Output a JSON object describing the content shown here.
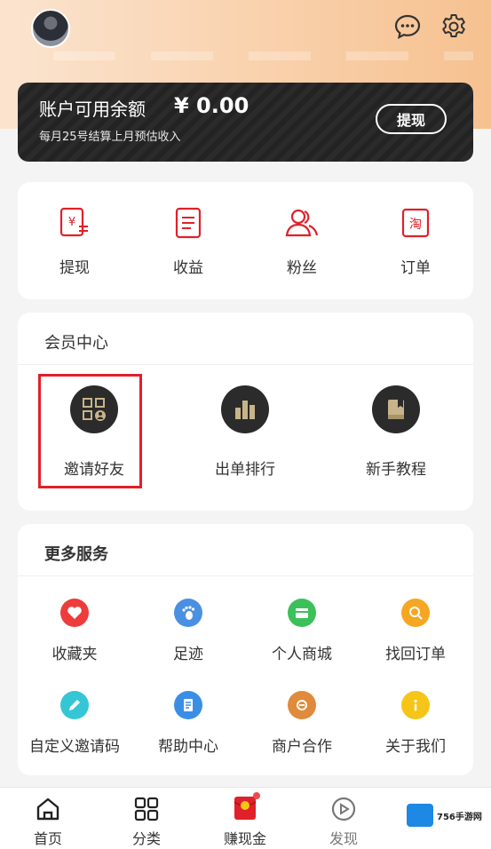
{
  "header": {
    "balance_title": "账户可用余额",
    "balance_amount": "¥ 0.00",
    "balance_subtitle": "每月25号结算上月预估收入",
    "withdraw_button": "提现"
  },
  "quick_actions": [
    {
      "label": "提现",
      "icon": "withdraw-icon"
    },
    {
      "label": "收益",
      "icon": "earnings-icon"
    },
    {
      "label": "粉丝",
      "icon": "fans-icon"
    },
    {
      "label": "订单",
      "icon": "taobao-order-icon"
    }
  ],
  "member_center": {
    "title": "会员中心",
    "items": [
      {
        "label": "邀请好友",
        "icon": "qr-invite-icon"
      },
      {
        "label": "出单排行",
        "icon": "ranking-icon"
      },
      {
        "label": "新手教程",
        "icon": "tutorial-book-icon"
      }
    ]
  },
  "more_services": {
    "title": "更多服务",
    "items": [
      {
        "label": "收藏夹",
        "icon": "heart-icon",
        "color": "#ee3b3b"
      },
      {
        "label": "足迹",
        "icon": "footprint-icon",
        "color": "#4a90e2"
      },
      {
        "label": "个人商城",
        "icon": "mall-icon",
        "color": "#3cc05a"
      },
      {
        "label": "找回订单",
        "icon": "search-order-icon",
        "color": "#f5a623"
      },
      {
        "label": "自定义邀请码",
        "icon": "edit-icon",
        "color": "#35c6d6"
      },
      {
        "label": "帮助中心",
        "icon": "help-icon",
        "color": "#3a8ee6"
      },
      {
        "label": "商户合作",
        "icon": "cooperation-icon",
        "color": "#e08a3c"
      },
      {
        "label": "关于我们",
        "icon": "info-icon",
        "color": "#f5c518"
      }
    ]
  },
  "tabbar": [
    {
      "label": "首页",
      "icon": "home-icon"
    },
    {
      "label": "分类",
      "icon": "category-icon"
    },
    {
      "label": "赚现金",
      "icon": "red-envelope-icon"
    },
    {
      "label": "发现",
      "icon": "play-icon"
    }
  ],
  "watermark": {
    "text": "756手游网"
  },
  "colors": {
    "accent": "#e0202a",
    "card_dark": "#2b2b2b"
  }
}
